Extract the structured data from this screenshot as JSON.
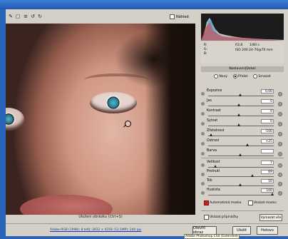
{
  "toolbar": {
    "preview_label": "Náhled",
    "icons": [
      "brush-icon",
      "crop-icon",
      "straighten-icon",
      "rotate-left-icon",
      "rotate-right-icon"
    ]
  },
  "image": {
    "caption": "Uložení obrázku (Ctrl+S)"
  },
  "readout": {
    "rgb_labels": [
      "R:",
      "G:",
      "B:"
    ],
    "fstop": "f/2,8",
    "shutter": "1/60 s",
    "iso_focal": "ISO 200   24-70@70 mm"
  },
  "panel": {
    "tab_title": "Nastavení|Detail",
    "radios": [
      {
        "label": "Nový",
        "checked": false
      },
      {
        "label": "Přidat",
        "checked": true
      },
      {
        "label": "Smazat",
        "checked": false
      }
    ],
    "sliders": [
      {
        "label": "Expozice",
        "value": "0,00",
        "level": 0.5
      },
      {
        "label": "Jas",
        "value": "0",
        "level": 0.48
      },
      {
        "label": "Kontrast",
        "value": "0",
        "level": 0.48
      },
      {
        "label": "Sytost",
        "value": "0",
        "level": 0.48
      },
      {
        "label": "Zřetelnost",
        "value": "-100",
        "level": 0.05
      },
      {
        "label": "Ostrost",
        "value": "+25",
        "level": 0.62
      },
      {
        "label": "Barva",
        "value": "",
        "level": 0.5
      }
    ],
    "sliders2": [
      {
        "label": "Velikost",
        "value": "7",
        "level": 0.12
      },
      {
        "label": "Prolnutí",
        "value": "69",
        "level": 0.69
      },
      {
        "label": "Tok",
        "value": "50",
        "level": 0.5
      },
      {
        "label": "Hustota",
        "value": "100",
        "level": 1.0
      }
    ],
    "auto_mask_label": "Automatická maska",
    "show_mask_label": "Ukázat masku",
    "show_pins_label": "Ukázat připínáčky",
    "clear_all_label": "Vymazat vše"
  },
  "status": {
    "link": "Adobe RGB (1998); 8 bitů; 2832 × 4256 (12,1MP); 240 ppi",
    "open_button": "Otevřít obraz",
    "save_button": "Uložit",
    "cancel_button": "Hotovo",
    "tooltip": "Adobe Photoshop CS4 (Extended)"
  },
  "colors": {
    "accent": "#2a64b8",
    "mask_red": "#d01f1f"
  }
}
